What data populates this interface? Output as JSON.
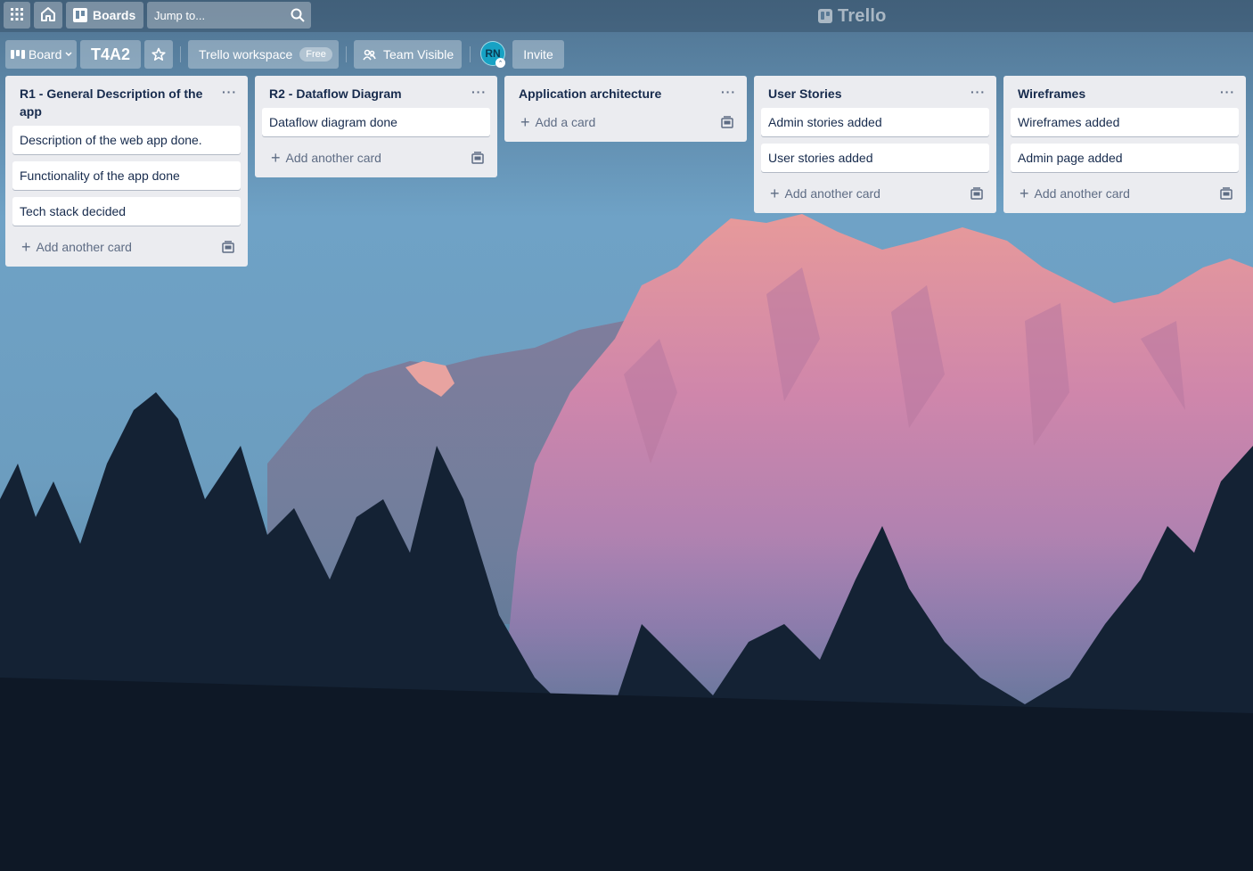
{
  "topbar": {
    "apps_icon": "grid-icon",
    "home_icon": "home-icon",
    "boards_label": "Boards",
    "jump_placeholder": "Jump to...",
    "logo_text": "Trello"
  },
  "board_header": {
    "view_label": "Board",
    "board_name": "T4A2",
    "workspace_label": "Trello workspace",
    "workspace_badge": "Free",
    "visibility_label": "Team Visible",
    "avatar_initials": "RN",
    "invite_label": "Invite"
  },
  "lists": [
    {
      "title": "R1 - General Description of the app",
      "cards": [
        "Description of the web app done.",
        "Functionality of the app done",
        "Tech stack decided"
      ],
      "add_label": "Add another card"
    },
    {
      "title": "R2 - Dataflow Diagram",
      "cards": [
        "Dataflow diagram done"
      ],
      "add_label": "Add another card"
    },
    {
      "title": "Application architecture",
      "cards": [],
      "add_label": "Add a card"
    },
    {
      "title": "User Stories",
      "cards": [
        "Admin stories added",
        "User stories added"
      ],
      "add_label": "Add another card"
    },
    {
      "title": "Wireframes",
      "cards": [
        "Wireframes added",
        "Admin page added"
      ],
      "add_label": "Add another card"
    }
  ],
  "colors": {
    "list_bg": "#ebecf0",
    "card_text": "#172b4d",
    "muted_text": "#5e6c84",
    "mountain_pink": "#d98aa6"
  }
}
